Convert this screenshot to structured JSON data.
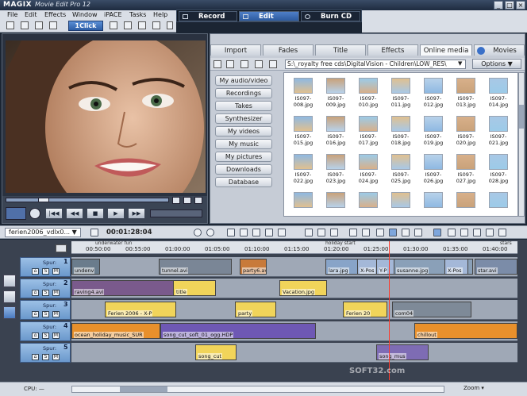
{
  "window": {
    "logo": "MAGIX",
    "title": "Movie Edit Pro 12"
  },
  "menu": [
    "File",
    "Edit",
    "Effects",
    "Window",
    "iPACE",
    "Tasks",
    "Help"
  ],
  "modes": [
    {
      "label": "Record"
    },
    {
      "label": "Edit",
      "active": true
    },
    {
      "label": "Burn CD"
    }
  ],
  "toolbar": {
    "click_label": "1Click"
  },
  "media": {
    "tabs": [
      "Import",
      "Fades",
      "Title",
      "Effects",
      "Online media",
      "Movies"
    ],
    "path": "S:\\_royalty free cds\\DigitalVision - Children\\LOW_RES\\",
    "options_label": "Options",
    "categories": [
      "My audio/video",
      "Recordings",
      "Takes",
      "Synthesizer",
      "My videos",
      "My music",
      "My pictures",
      "Downloads",
      "Database"
    ],
    "files": [
      "IS097-008.jpg",
      "IS097-009.jpg",
      "IS097-010.jpg",
      "IS097-011.jpg",
      "IS097-012.jpg",
      "IS097-013.jpg",
      "IS097-014.jpg",
      "IS097-015.jpg",
      "IS097-016.jpg",
      "IS097-017.jpg",
      "IS097-018.jpg",
      "IS097-019.jpg",
      "IS097-020.jpg",
      "IS097-021.jpg",
      "IS097-022.jpg",
      "IS097-023.jpg",
      "IS097-024.jpg",
      "IS097-025.jpg",
      "IS097-026.jpg",
      "IS097-027.jpg",
      "IS097-028.jpg",
      "",
      "",
      "",
      "",
      "",
      "",
      ""
    ]
  },
  "timeline": {
    "project": "ferien2006_vdlx0...",
    "timecode": "00:01:28:04",
    "ruler": [
      "00:50:00",
      "00:55:00",
      "01:00:00",
      "01:05:00",
      "01:10:00",
      "01:15:00",
      "01:20:00",
      "01:25:00",
      "01:30:00",
      "01:35:00",
      "01:40:00"
    ],
    "markers": [
      "underwater fun",
      "holiday start",
      "stars"
    ],
    "tracks": [
      {
        "label": "Spur:",
        "num": "1"
      },
      {
        "label": "Spur:",
        "num": "2"
      },
      {
        "label": "Spur:",
        "num": "3"
      },
      {
        "label": "Spur:",
        "num": "4"
      },
      {
        "label": "Spur:",
        "num": "5"
      }
    ],
    "clips": {
      "t1": [
        "undenv",
        "tunnel.avi",
        "party6.avi",
        "lara.jpg",
        "X-Pos",
        "Y-P",
        "susanne.jpg",
        "X-Pos",
        "star.avi"
      ],
      "t2": [
        "raving4.avi",
        "title",
        "Vacation.jpg"
      ],
      "t3": [
        "Ferien 2006 - X-P",
        "party",
        "Ferien 20",
        "com04"
      ],
      "t4": [
        "ocean_holiday_music_SUR",
        "song_cut_soft_01_ogg.HDP",
        "chillout"
      ],
      "t5": [
        "song_cut",
        "song_mus"
      ]
    },
    "track_buttons": [
      "S",
      "M"
    ],
    "cpu_label": "CPU: —",
    "zoom_label": "Zoom"
  },
  "watermark": "SOFT32.com"
}
